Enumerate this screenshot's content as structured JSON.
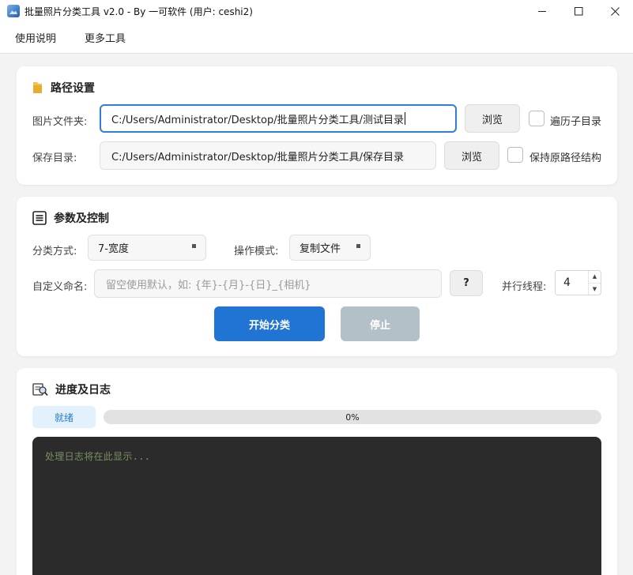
{
  "window": {
    "title": "批量照片分类工具 v2.0 - By 一可软件 (用户: ceshi2)",
    "minimize": "–",
    "maximize": "□",
    "close": "✕"
  },
  "menu": {
    "items": [
      {
        "label": "使用说明"
      },
      {
        "label": "更多工具"
      }
    ]
  },
  "path_settings": {
    "title": "路径设置",
    "image_folder_label": "图片文件夹:",
    "image_folder_value": "C:/Users/Administrator/Desktop/批量照片分类工具/测试目录",
    "browse_label": "浏览",
    "traverse_subdirs_label": "遍历子目录",
    "save_dir_label": "保存目录:",
    "save_dir_value": "C:/Users/Administrator/Desktop/批量照片分类工具/保存目录",
    "browse2_label": "浏览",
    "keep_structure_label": "保持原路径结构"
  },
  "params": {
    "title": "参数及控制",
    "classify_label": "分类方式:",
    "classify_value": "7-宽度",
    "mode_label": "操作模式:",
    "mode_value": "复制文件",
    "naming_label": "自定义命名:",
    "naming_placeholder": "留空使用默认，如: {年}-{月}-{日}_{相机}",
    "help_label": "?",
    "threads_label": "并行线程:",
    "threads_value": "4",
    "start_label": "开始分类",
    "stop_label": "停止"
  },
  "progress": {
    "title": "进度及日志",
    "status": "就绪",
    "percent": 0,
    "percent_text": "0%",
    "log_placeholder": "处理日志将在此显示..."
  },
  "colors": {
    "accent": "#1f74d4",
    "disabled": "#b3c0c8",
    "log_bg": "#2b2b2b",
    "log_text": "#7a8f63"
  }
}
